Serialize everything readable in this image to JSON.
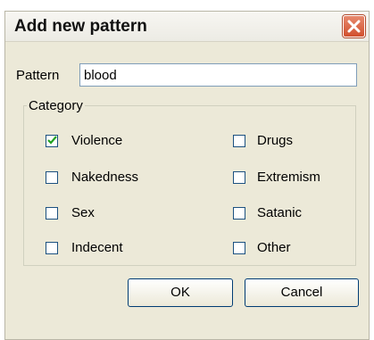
{
  "window": {
    "title": "Add new pattern"
  },
  "pattern": {
    "label": "Pattern",
    "value": "blood"
  },
  "category": {
    "legend": "Category",
    "items": [
      {
        "label": "Violence",
        "checked": true
      },
      {
        "label": "Drugs",
        "checked": false
      },
      {
        "label": "Nakedness",
        "checked": false
      },
      {
        "label": "Extremism",
        "checked": false
      },
      {
        "label": "Sex",
        "checked": false
      },
      {
        "label": "Satanic",
        "checked": false
      },
      {
        "label": "Indecent",
        "checked": false
      },
      {
        "label": "Other",
        "checked": false
      }
    ]
  },
  "buttons": {
    "ok": "OK",
    "cancel": "Cancel"
  },
  "icons": {
    "close": "close-icon",
    "check": "checkmark-icon"
  },
  "colors": {
    "dialog_bg": "#ece9d8",
    "close_button": "#d1502e",
    "input_border": "#7f9db9"
  }
}
